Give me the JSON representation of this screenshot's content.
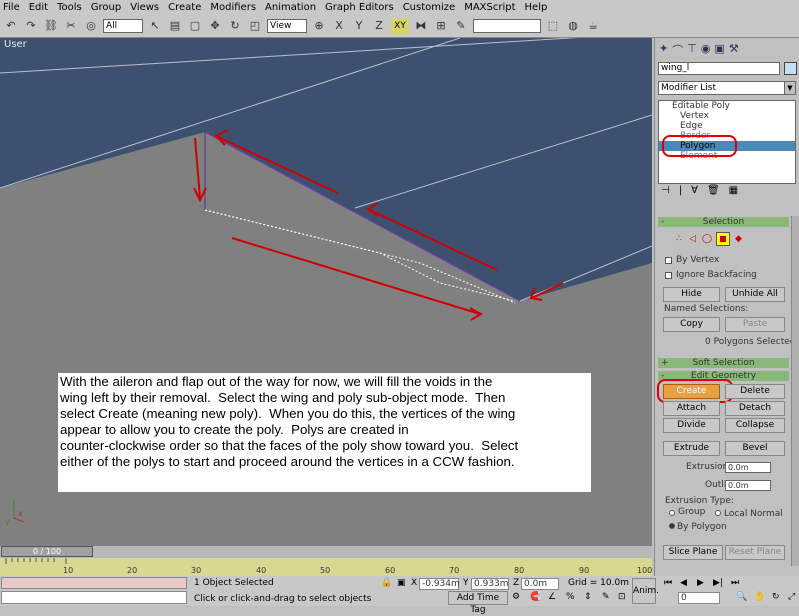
{
  "menu": [
    "File",
    "Edit",
    "Tools",
    "Group",
    "Views",
    "Create",
    "Modifiers",
    "Animation",
    "Graph Editors",
    "Customize",
    "MAXScript",
    "Help"
  ],
  "toolbar": {
    "selection_filter": "All",
    "reference_coord": "View",
    "constraint_plane": "XY",
    "named_selection": ""
  },
  "viewport": {
    "label": "User"
  },
  "note_text": "With the aileron and flap out of the way for now, we will fill the voids in the\nwing left by their removal.  Select the wing and poly sub-object mode.  Then\nselect Create (meaning new poly).  When you do this, the vertices of the wing\nappear to allow you to create the poly.  Polys are created in\ncounter-clockwise order so that the faces of the poly show toward you.  Select\neither of the polys to start and proceed around the vertices in a CCW fashion.",
  "timeline": {
    "slider": "0 / 100",
    "ticks": [
      "10",
      "20",
      "30",
      "40",
      "50",
      "60",
      "70",
      "80",
      "90",
      "100"
    ]
  },
  "status": {
    "selected": "1 Object Selected",
    "prompt": "Click or click-and-drag to select objects",
    "x_label": "X",
    "x_value": "-0.934m",
    "y_label": "Y",
    "y_value": "0.933m",
    "z_label": "Z",
    "z_value": "0.0m",
    "grid": "Grid = 10.0m",
    "add_time_tag": "Add Time Tag",
    "anim_label": "Anim.",
    "frame": "0"
  },
  "panel": {
    "object_name": "wing_l",
    "modifier_list": "Modifier List",
    "stack": {
      "root": "Editable Poly",
      "items": [
        "Vertex",
        "Edge",
        "Border",
        "Polygon",
        "Element"
      ],
      "selected": "Polygon"
    },
    "selection": {
      "title": "Selection",
      "by_vertex": "By Vertex",
      "ignore_backfacing": "Ignore Backfacing",
      "hide": "Hide",
      "unhide_all": "Unhide All",
      "named_selections": "Named Selections:",
      "copy": "Copy",
      "paste": "Paste",
      "count": "0 Polygons Selected"
    },
    "soft_selection": "Soft Selection",
    "edit_geometry": {
      "title": "Edit Geometry",
      "create": "Create",
      "delete": "Delete",
      "attach": "Attach",
      "detach": "Detach",
      "divide": "Divide",
      "collapse": "Collapse",
      "extrude": "Extrude",
      "bevel": "Bevel",
      "extrusion_label": "Extrusion:",
      "extrusion_value": "0.0m",
      "outline_label": "Outline",
      "outline_value": "0.0m",
      "extrusion_type": "Extrusion Type:",
      "group": "Group",
      "local_normal": "Local Normal",
      "by_polygon": "By Polygon",
      "slice_plane": "Slice Plane",
      "reset_plane": "Reset Plane"
    }
  },
  "colors": {
    "viewport_bg": "#808080",
    "wing_surface": "#3d5070",
    "annotation": "#d00000",
    "active_create": "#e8a040",
    "rollout_header": "#8ab878"
  }
}
